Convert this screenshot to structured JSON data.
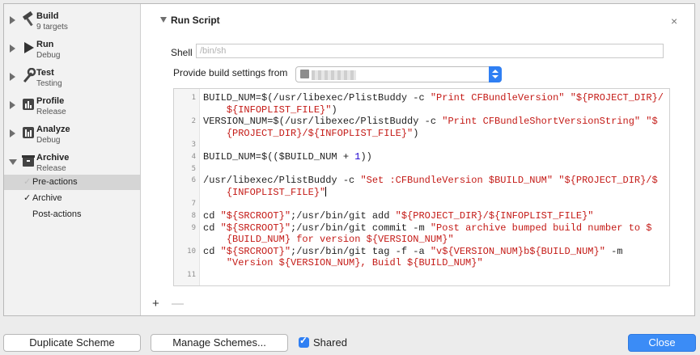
{
  "sidebar": {
    "actions": [
      {
        "name": "Build",
        "sub": "9 targets",
        "icon": "hammer-icon"
      },
      {
        "name": "Run",
        "sub": "Debug",
        "icon": "play-icon"
      },
      {
        "name": "Test",
        "sub": "Testing",
        "icon": "wrench-icon"
      },
      {
        "name": "Profile",
        "sub": "Release",
        "icon": "gauge-icon"
      },
      {
        "name": "Analyze",
        "sub": "Debug",
        "icon": "analyze-icon"
      },
      {
        "name": "Archive",
        "sub": "Release",
        "icon": "archive-box-icon"
      }
    ],
    "archive_items": [
      {
        "label": "Pre-actions",
        "check": "✓",
        "selected": true
      },
      {
        "label": "Archive",
        "check": "✓",
        "selected": false
      },
      {
        "label": "Post-actions",
        "check": "",
        "selected": false
      }
    ]
  },
  "phase": {
    "title": "Run Script",
    "close": "×",
    "shell_label": "Shell",
    "shell_placeholder": "/bin/sh",
    "settings_label": "Provide build settings from"
  },
  "editor": {
    "gutter": [
      "1",
      "",
      "2",
      "",
      "3",
      "4",
      "5",
      "6",
      "",
      "7",
      "8",
      "9",
      "",
      "10",
      "",
      "11"
    ],
    "lines": [
      [
        {
          "t": "BUILD_NUM=$(/usr/libexec/PlistBuddy -c "
        },
        {
          "t": "\"Print CFBundleVersion\"",
          "c": "str"
        },
        {
          "t": " "
        },
        {
          "t": "\"${PROJECT_DIR}/",
          "c": "str"
        }
      ],
      [
        {
          "t": "    "
        },
        {
          "t": "${INFOPLIST_FILE}\"",
          "c": "str"
        },
        {
          "t": ")"
        }
      ],
      [
        {
          "t": "VERSION_NUM=$(/usr/libexec/PlistBuddy -c "
        },
        {
          "t": "\"Print CFBundleShortVersionString\"",
          "c": "str"
        },
        {
          "t": " "
        },
        {
          "t": "\"$",
          "c": "str"
        }
      ],
      [
        {
          "t": "    "
        },
        {
          "t": "{PROJECT_DIR}/${INFOPLIST_FILE}\"",
          "c": "str"
        },
        {
          "t": ")"
        }
      ],
      [
        {
          "t": ""
        }
      ],
      [
        {
          "t": "BUILD_NUM=$(($BUILD_NUM + "
        },
        {
          "t": "1",
          "c": "num"
        },
        {
          "t": "))"
        }
      ],
      [
        {
          "t": ""
        }
      ],
      [
        {
          "t": "/usr/libexec/PlistBuddy -c "
        },
        {
          "t": "\"Set :CFBundleVersion $BUILD_NUM\"",
          "c": "str"
        },
        {
          "t": " "
        },
        {
          "t": "\"${PROJECT_DIR}/$",
          "c": "str"
        }
      ],
      [
        {
          "t": "    "
        },
        {
          "t": "{INFOPLIST_FILE}\"",
          "c": "str"
        },
        {
          "t": "",
          "cursor": true
        }
      ],
      [
        {
          "t": ""
        }
      ],
      [
        {
          "t": "cd "
        },
        {
          "t": "\"${SRCROOT}\"",
          "c": "str"
        },
        {
          "t": ";/usr/bin/git add "
        },
        {
          "t": "\"${PROJECT_DIR}/${INFOPLIST_FILE}\"",
          "c": "str"
        }
      ],
      [
        {
          "t": "cd "
        },
        {
          "t": "\"${SRCROOT}\"",
          "c": "str"
        },
        {
          "t": ";/usr/bin/git commit -m "
        },
        {
          "t": "\"Post archive bumped build number to $",
          "c": "str"
        }
      ],
      [
        {
          "t": "    "
        },
        {
          "t": "{BUILD_NUM} for version ${VERSION_NUM}\"",
          "c": "str"
        }
      ],
      [
        {
          "t": "cd "
        },
        {
          "t": "\"${SRCROOT}\"",
          "c": "str"
        },
        {
          "t": ";/usr/bin/git tag -f -a "
        },
        {
          "t": "\"v${VERSION_NUM}b${BUILD_NUM}\"",
          "c": "str"
        },
        {
          "t": " -m"
        }
      ],
      [
        {
          "t": "    "
        },
        {
          "t": "\"Version ${VERSION_NUM}, Buidl ${BUILD_NUM}\"",
          "c": "str"
        }
      ],
      [
        {
          "t": ""
        }
      ]
    ]
  },
  "controls": {
    "add": "+",
    "remove": "—"
  },
  "footer": {
    "duplicate": "Duplicate Scheme",
    "manage": "Manage Schemes...",
    "shared": "Shared",
    "close": "Close"
  },
  "colors": {
    "accent": "#2f7ff3",
    "string": "#c41a16",
    "number": "#1c00cf"
  }
}
